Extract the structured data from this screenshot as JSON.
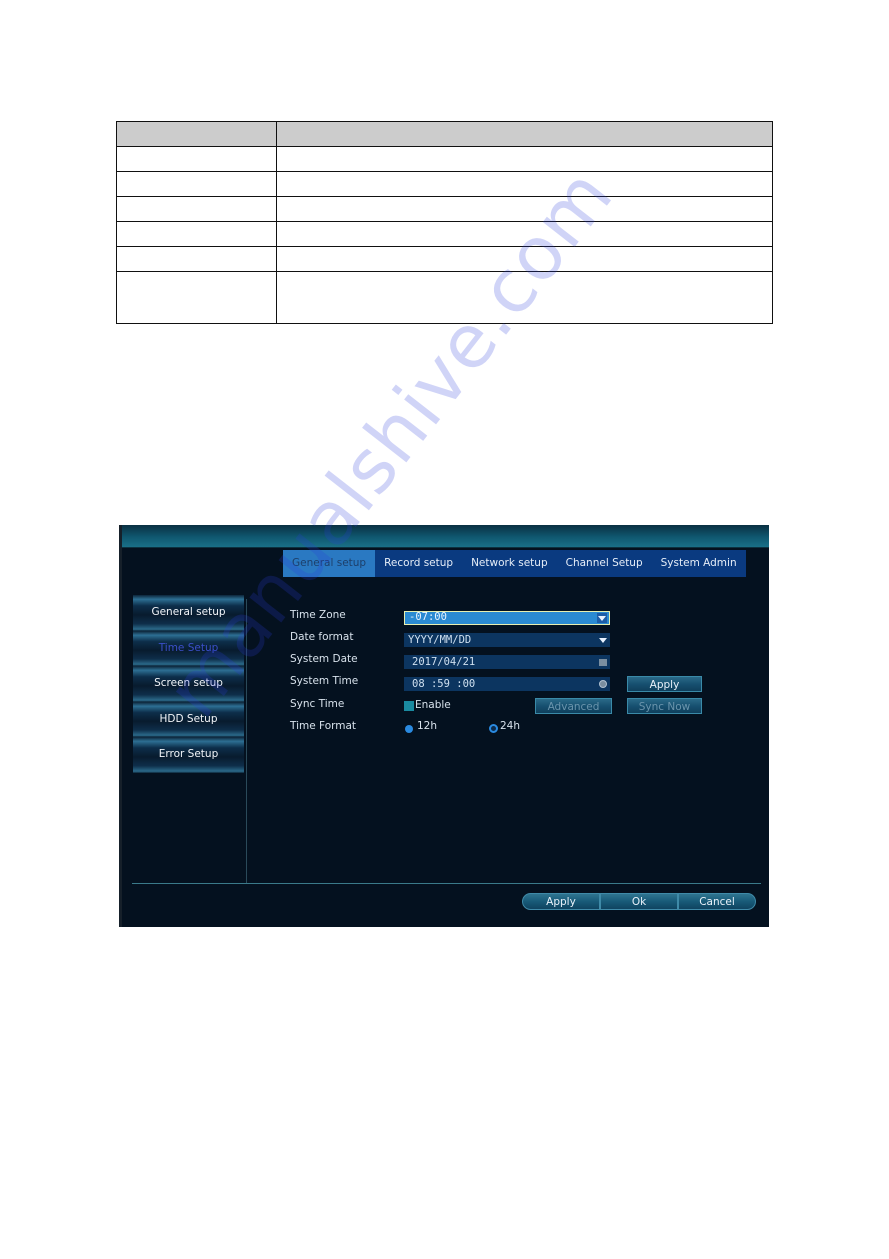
{
  "doc_table": {
    "rows": [
      {
        "col1": "",
        "col2": ""
      },
      {
        "col1": "",
        "col2": ""
      },
      {
        "col1": "",
        "col2": ""
      },
      {
        "col1": "",
        "col2": ""
      },
      {
        "col1": "",
        "col2": ""
      },
      {
        "col1": "",
        "col2": ""
      },
      {
        "col1": "",
        "col2": ""
      }
    ]
  },
  "dvr": {
    "tabs": [
      {
        "label": "General setup",
        "active": true
      },
      {
        "label": "Record setup",
        "active": false
      },
      {
        "label": "Network setup",
        "active": false
      },
      {
        "label": "Channel Setup",
        "active": false
      },
      {
        "label": "System Admin",
        "active": false
      }
    ],
    "sidebar": [
      {
        "label": "General setup",
        "active": false
      },
      {
        "label": "Time Setup",
        "active": true
      },
      {
        "label": "Screen setup",
        "active": false
      },
      {
        "label": "HDD Setup",
        "active": false
      },
      {
        "label": "Error Setup",
        "active": false
      }
    ],
    "form": {
      "time_zone": {
        "label": "Time Zone",
        "value": "-07:00",
        "icon": "dropdown-arrow-icon"
      },
      "date_format": {
        "label": "Date format",
        "value": "YYYY/MM/DD",
        "icon": "dropdown-arrow-icon"
      },
      "system_date": {
        "label": "System Date",
        "value": "2017/04/21",
        "icon": "calendar-icon"
      },
      "system_time": {
        "label": "System Time",
        "value": "08 :59 :00",
        "icon": "clock-icon"
      },
      "sync_time": {
        "label": "Sync Time",
        "checkbox_label": "Enable",
        "checked": true
      },
      "time_format": {
        "label": "Time Format",
        "options": [
          "12h",
          "24h"
        ],
        "selected": "12h"
      }
    },
    "buttons": {
      "apply_time": "Apply",
      "advanced": "Advanced",
      "sync_now": "Sync Now"
    },
    "footer": {
      "apply": "Apply",
      "ok": "Ok",
      "cancel": "Cancel"
    },
    "colors": {
      "background": "#04111f",
      "tab_bar": "#0a3a80",
      "tab_active": "#2a79c2",
      "sidebar_active_text": "#3a4fc8"
    }
  },
  "watermark": "manualshive.com"
}
